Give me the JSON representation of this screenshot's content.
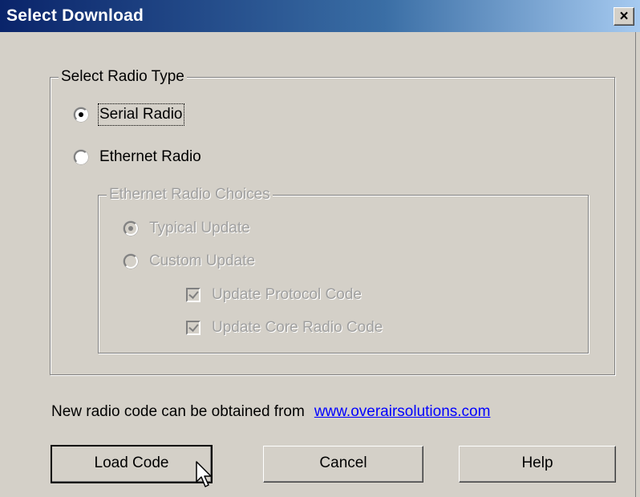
{
  "window": {
    "title": "Select Download",
    "close_glyph": "×"
  },
  "radio_group": {
    "legend": "Select Radio Type",
    "options": [
      {
        "label": "Serial Radio",
        "checked": true
      },
      {
        "label": "Ethernet Radio",
        "checked": false
      }
    ]
  },
  "ethernet_group": {
    "legend": "Ethernet Radio Choices",
    "options": [
      {
        "label": "Typical Update",
        "checked": true
      },
      {
        "label": "Custom Update",
        "checked": false
      }
    ],
    "checkboxes": [
      {
        "label": "Update Protocol Code",
        "checked": true
      },
      {
        "label": "Update Core Radio Code",
        "checked": true
      }
    ]
  },
  "info": {
    "text": "New radio code can be obtained from",
    "link": "www.overairsolutions.com"
  },
  "buttons": {
    "load": "Load Code",
    "cancel": "Cancel",
    "help": "Help"
  },
  "icons": {
    "close": "close-icon",
    "cursor": "mouse-pointer-icon"
  }
}
